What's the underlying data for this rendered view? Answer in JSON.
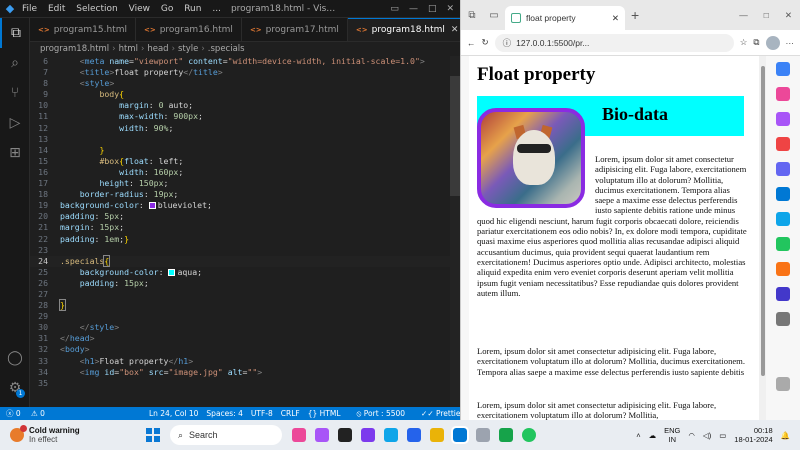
{
  "vscode": {
    "menu": [
      "File",
      "Edit",
      "Selection",
      "View",
      "Go",
      "Run",
      "..."
    ],
    "window_title": "program18.html - Visual...",
    "tabs": [
      {
        "label": "program15.html",
        "active": false
      },
      {
        "label": "program16.html",
        "active": false
      },
      {
        "label": "program17.html",
        "active": false
      },
      {
        "label": "program18.html",
        "active": true
      }
    ],
    "breadcrumbs": [
      "program18.html",
      "html",
      "head",
      "style",
      ".specials"
    ],
    "code": [
      {
        "n": "6"
      },
      {
        "n": "7"
      },
      {
        "n": "8"
      },
      {
        "n": "9"
      },
      {
        "n": "10"
      },
      {
        "n": "11"
      },
      {
        "n": "12"
      },
      {
        "n": "13"
      },
      {
        "n": "14"
      },
      {
        "n": "15"
      },
      {
        "n": "16"
      },
      {
        "n": "17"
      },
      {
        "n": "18"
      },
      {
        "n": "19"
      },
      {
        "n": "20"
      },
      {
        "n": "21"
      },
      {
        "n": "22"
      },
      {
        "n": "23"
      },
      {
        "n": "24"
      },
      {
        "n": "25"
      },
      {
        "n": "26"
      },
      {
        "n": "27"
      },
      {
        "n": "28"
      },
      {
        "n": "29"
      },
      {
        "n": "30"
      },
      {
        "n": "31"
      },
      {
        "n": "32"
      },
      {
        "n": "33"
      },
      {
        "n": "34"
      },
      {
        "n": "35"
      }
    ],
    "status": {
      "errors": "0",
      "warnings": "0",
      "position": "Ln 24, Col 10",
      "spaces": "Spaces: 4",
      "encoding": "UTF-8",
      "eol": "CRLF",
      "language": "HTML",
      "port": "Port : 5500",
      "prettier": "Prettier"
    },
    "accounts_badge": "1"
  },
  "browser": {
    "tab_title": "float property",
    "url": "127.0.0.1:5500/pr...",
    "page": {
      "heading": "Float property",
      "bio_heading": "Bio-data",
      "para1": "Lorem, ipsum dolor sit amet consectetur adipisicing elit. Fuga labore, exercitationem voluptatum illo at dolorum? Mollitia, ducimus exercitationem. Tempora alias saepe a maxime esse delectus perferendis iusto sapiente debitis ratione unde minus quod hic eligendi nesciunt, harum fugit corporis obcaecati dolore, reiciendis pariatur exercitationem eos odio nobis? In, ex dolore modi tempora, cupiditate quasi maxime eius asperiores quod mollitia alias recusandae adipisci aliquid accusantium ducimus, quia provident sequi quaerat laudantium rem exercitationem! Ducimus asperiores optio unde. Adipisci architecto, molestias aliquid expedita enim vero eveniet corporis deserunt aperiam velit mollitia ipsum fugit veniam necessitatibus? Esse repudiandae quis dolores provident autem illum.",
      "para2": "Lorem, ipsum dolor sit amet consectetur adipisicing elit. Fuga labore, exercitationem voluptatum illo at dolorum? Mollitia, ducimus exercitationem. Tempora alias saepe a maxime esse delectus perferendis iusto sapiente debitis",
      "para3": "Lorem, ipsum dolor sit amet consectetur adipisicing elit. Fuga labore, exercitationem voluptatum illo at dolorum? Mollitia,"
    }
  },
  "taskbar": {
    "weather_title": "Cold warning",
    "weather_sub": "In effect",
    "search": "Search",
    "lang1": "ENG",
    "lang2": "IN",
    "time": "00:18",
    "date": "18-01-2024"
  },
  "colors": {
    "accent": "#0078d4",
    "aqua": "#00ffff",
    "blueviolet": "#8a2be2"
  }
}
